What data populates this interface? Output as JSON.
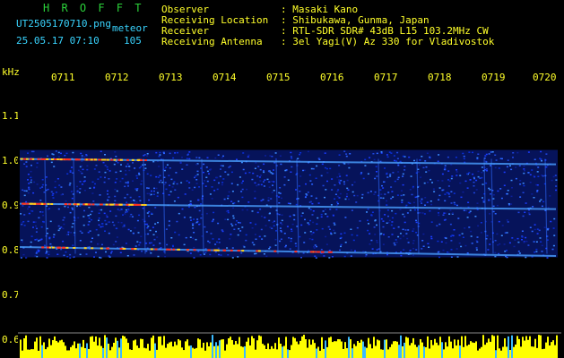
{
  "header": {
    "title": "H R O F F T",
    "filename": "UT2505170710.png",
    "meteor_label": "meteor",
    "datetime": "25.05.17 07:10",
    "meteor_count": "105",
    "fields": [
      {
        "label": "Observer",
        "value": ": Masaki Kano"
      },
      {
        "label": "Receiving Location",
        "value": ": Shibukawa, Gunma, Japan"
      },
      {
        "label": "Receiver",
        "value": ": RTL-SDR SDR# 43dB L15 103.2MHz CW"
      },
      {
        "label": "Receiving Antenna",
        "value": ": 3el Yagi(V) Az 330 for Vladivostok"
      }
    ]
  },
  "chart_data": {
    "type": "heatmap",
    "ylabel": "kHz",
    "y_ticks": [
      "1.1",
      "1.0",
      "0.9",
      "0.8",
      "0.7",
      "0.6"
    ],
    "ylim": [
      0.6,
      1.2
    ],
    "x_ticks": [
      "0711",
      "0712",
      "0713",
      "0714",
      "0715",
      "0716",
      "0717",
      "0718",
      "0719",
      "0720"
    ],
    "bands_khz": [
      1.0,
      0.9,
      0.8
    ],
    "colors": {
      "background": "#000000",
      "text": "#ffff2a",
      "signal": "#1a3cff",
      "hot": "#ff3020",
      "baseline": "#ffff00"
    }
  }
}
